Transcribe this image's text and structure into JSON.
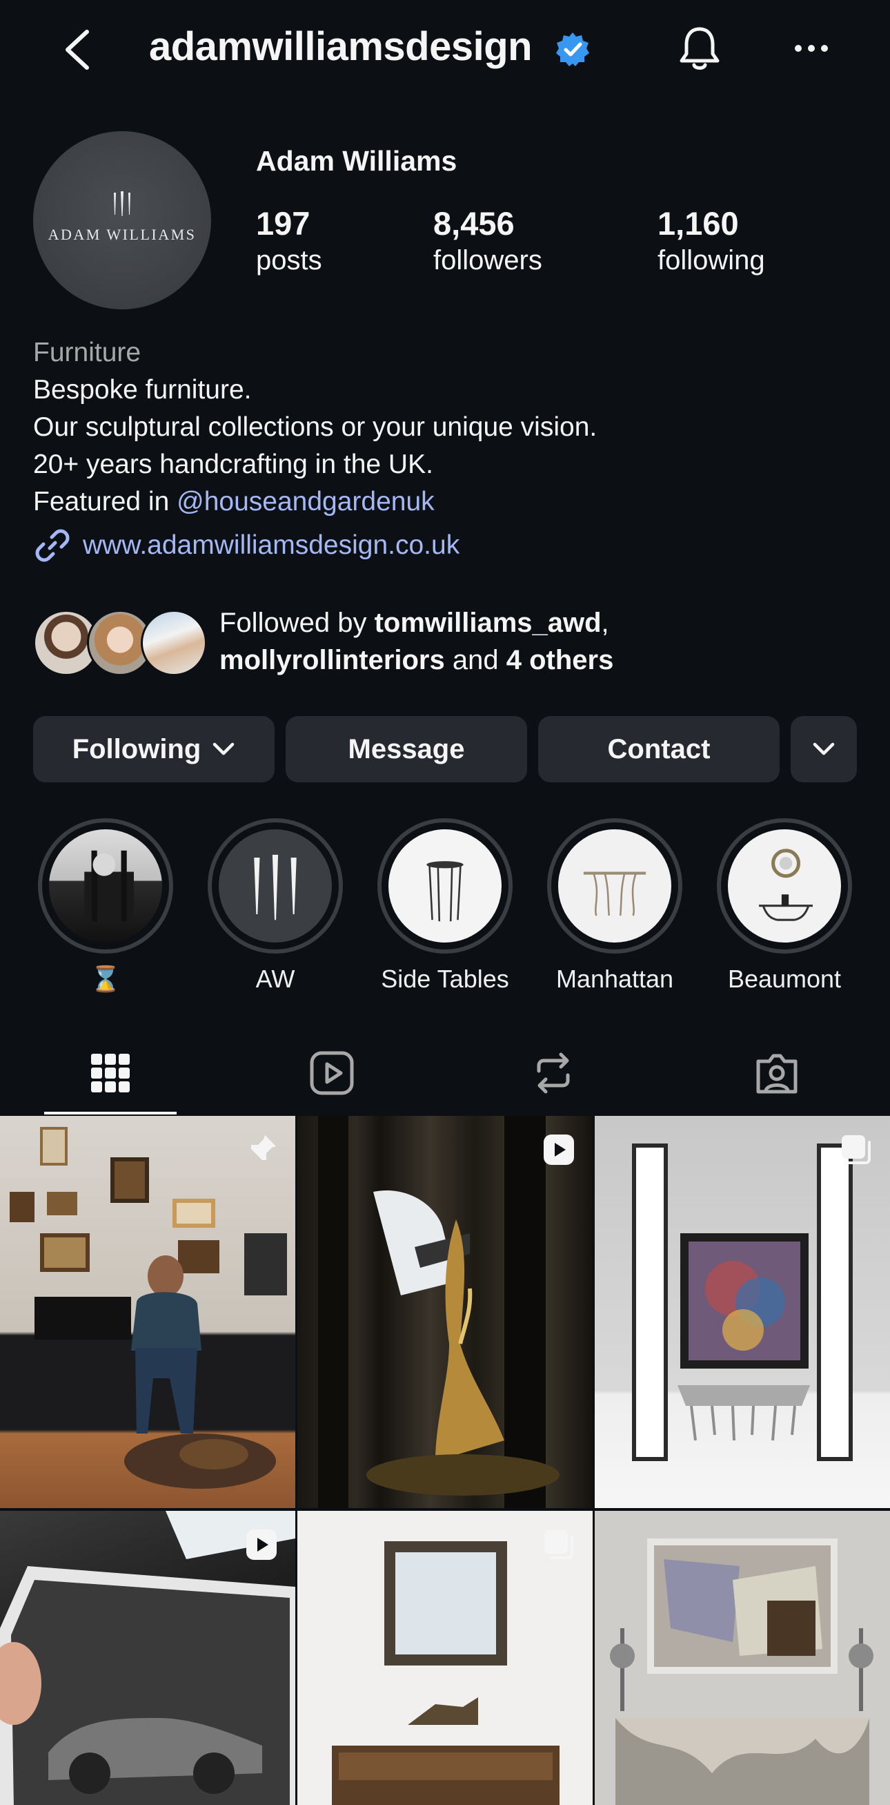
{
  "header": {
    "username": "adamwilliamsdesign"
  },
  "profile": {
    "avatar_text": "ADAM WILLIAMS",
    "display_name": "Adam Williams",
    "stats": {
      "posts": {
        "value": "197",
        "label": "posts"
      },
      "followers": {
        "value": "8,456",
        "label": "followers"
      },
      "following": {
        "value": "1,160",
        "label": "following"
      }
    }
  },
  "bio": {
    "category": "Furniture",
    "line1": "Bespoke furniture.",
    "line2": "Our sculptural collections or your unique vision.",
    "line3": "20+ years handcrafting in the UK.",
    "line4_prefix": "Featured in ",
    "line4_mention": "@houseandgardenuk",
    "website": "www.adamwilliamsdesign.co.uk"
  },
  "followed_by": {
    "prefix": "Followed by ",
    "user1": "tomwilliams_awd",
    "sep": ",",
    "user2": "mollyrollinteriors",
    "middle": " and ",
    "others": "4 others"
  },
  "actions": {
    "following": "Following",
    "message": "Message",
    "contact": "Contact"
  },
  "highlights": [
    {
      "label": "⌛"
    },
    {
      "label": "AW"
    },
    {
      "label": "Side Tables"
    },
    {
      "label": "Manhattan"
    },
    {
      "label": "Beaumont"
    }
  ],
  "tabs": [
    "posts-grid",
    "reels",
    "reposts",
    "tagged"
  ],
  "colors": {
    "background": "#0c1014",
    "button": "#262a30",
    "link": "#a4b8f5",
    "verified": "#3897f0"
  }
}
